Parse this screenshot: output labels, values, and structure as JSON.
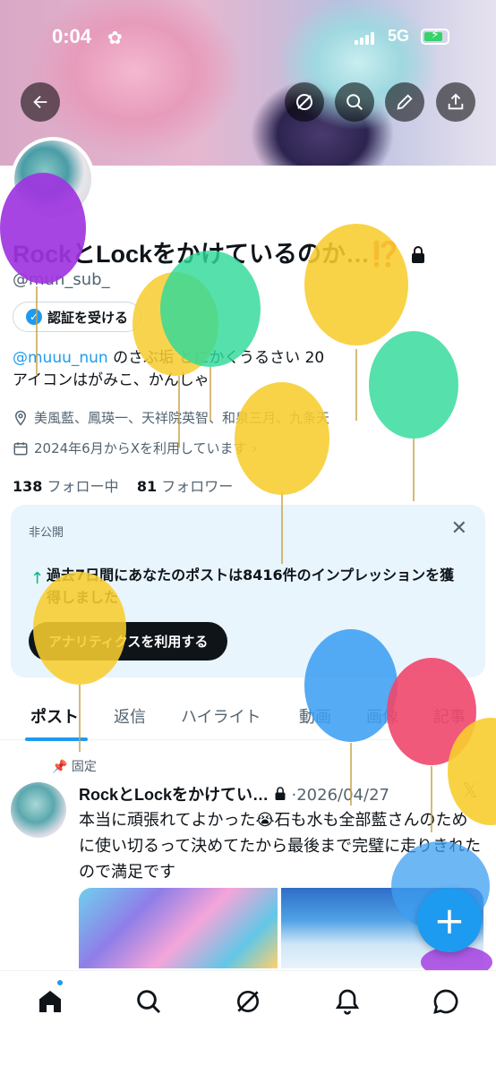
{
  "status_bar": {
    "time": "0:04",
    "network": "5G"
  },
  "profile": {
    "name": "RockとLockをかけているのか…",
    "name_emoji": "⁉️",
    "handle": "@mun_sub_",
    "verify_label": "認証を受ける",
    "bio_mention": "@muuu_nun",
    "bio_rest": " のさぶ垢 とにかくうるさい 20",
    "bio_line2": "アイコンはがみこ、かんしゃ",
    "location": "美風藍、鳳瑛一、天祥院英智、和泉三月、九条天",
    "joined": "2024年6月からXを利用しています",
    "following_count": "138",
    "following_label": "フォロー中",
    "followers_count": "81",
    "followers_label": "フォロワー"
  },
  "private_card": {
    "label": "非公開",
    "message": "過去7日間にあなたのポストは8416件のインプレッションを獲得しました",
    "cta": "アナリティクスを利用する"
  },
  "tabs": [
    "ポスト",
    "返信",
    "ハイライト",
    "動画",
    "画像",
    "記事"
  ],
  "post": {
    "pinned_label": "固定",
    "author": "RockとLockをかけてい…",
    "date": "·2026/04/27",
    "text": "本当に頑張れてよかった😭石も水も全部藍さんのために使い切るって決めてたから最後まで完璧に走りきれたので満足です"
  },
  "colors": {
    "accent": "#1d9bf0",
    "text": "#0f1419",
    "muted": "#536471"
  },
  "icons": [
    "back-icon",
    "grok-icon",
    "search-icon",
    "edit-icon",
    "share-icon",
    "home-icon",
    "bell-icon",
    "messages-icon",
    "x-logo-icon"
  ]
}
